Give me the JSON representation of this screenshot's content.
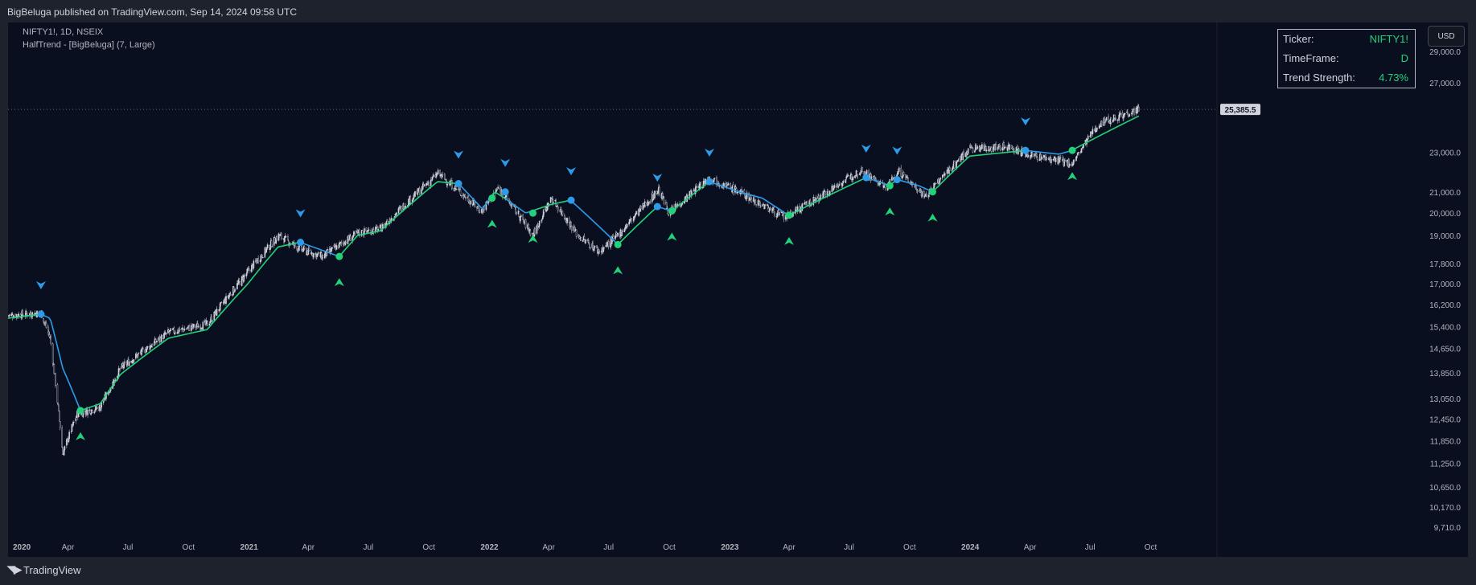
{
  "header": {
    "published": "BigBeluga published on TradingView.com, Sep 14, 2024 09:58 UTC"
  },
  "legend": {
    "symbol": "NIFTY1!, 1D, NSEIX",
    "indicator": "HalfTrend - [BigBeluga] (7, Large)"
  },
  "table": {
    "rows": [
      {
        "label": "Ticker:",
        "value": "NIFTY1!"
      },
      {
        "label": "TimeFrame:",
        "value": "D"
      },
      {
        "label": "Trend Strength:",
        "value": "4.73%"
      }
    ]
  },
  "currency_button": "USD",
  "brand": {
    "icon": "tradingview-logo-icon",
    "name": "TradingView"
  },
  "colors": {
    "bull": "#22d17a",
    "bear": "#2d9be8",
    "candle": "#d1d4dc",
    "background": "#0a0f1f",
    "frame": "#1e222d"
  },
  "chart_data": {
    "type": "candlestick",
    "scale": "log",
    "ylim": [
      9500,
      31000
    ],
    "y_ticks": [
      29000,
      27000,
      23000,
      21000,
      20000,
      19000,
      17800,
      17000,
      16200,
      15400,
      14650,
      13850,
      13050,
      12450,
      11850,
      11250,
      10650,
      10170,
      9710
    ],
    "y_tick_labels": [
      "29,000.0",
      "27,000.0",
      "23,000.0",
      "21,000.0",
      "20,000.0",
      "19,000.0",
      "17,800.0",
      "17,000.0",
      "16,200.0",
      "15,400.0",
      "14,650.0",
      "13,850.0",
      "13,050.0",
      "12,450.0",
      "11,850.0",
      "11,250.0",
      "10,650.0",
      "10,170.0",
      "9,710.0"
    ],
    "last_price": 25385.5,
    "last_price_label": "25,385.5",
    "x_start": "2020-01-01",
    "x_end": "2024-12-31",
    "x_ticks": [
      {
        "date": "2020-01-01",
        "label": "2020"
      },
      {
        "date": "2020-04-01",
        "label": "Apr"
      },
      {
        "date": "2020-07-01",
        "label": "Jul"
      },
      {
        "date": "2020-10-01",
        "label": "Oct"
      },
      {
        "date": "2021-01-01",
        "label": "2021"
      },
      {
        "date": "2021-04-01",
        "label": "Apr"
      },
      {
        "date": "2021-07-01",
        "label": "Jul"
      },
      {
        "date": "2021-10-01",
        "label": "Oct"
      },
      {
        "date": "2022-01-01",
        "label": "2022"
      },
      {
        "date": "2022-04-01",
        "label": "Apr"
      },
      {
        "date": "2022-07-01",
        "label": "Jul"
      },
      {
        "date": "2022-10-01",
        "label": "Oct"
      },
      {
        "date": "2023-01-01",
        "label": "2023"
      },
      {
        "date": "2023-04-01",
        "label": "Apr"
      },
      {
        "date": "2023-07-01",
        "label": "Jul"
      },
      {
        "date": "2023-10-01",
        "label": "Oct"
      },
      {
        "date": "2024-01-01",
        "label": "2024"
      },
      {
        "date": "2024-04-01",
        "label": "Apr"
      },
      {
        "date": "2024-07-01",
        "label": "Jul"
      },
      {
        "date": "2024-10-01",
        "label": "Oct"
      }
    ],
    "price_path": [
      [
        "2020-01-01",
        15800
      ],
      [
        "2020-02-20",
        15900
      ],
      [
        "2020-03-05",
        15000
      ],
      [
        "2020-03-24",
        11500
      ],
      [
        "2020-04-15",
        12600
      ],
      [
        "2020-05-20",
        12800
      ],
      [
        "2020-06-20",
        14000
      ],
      [
        "2020-09-01",
        15200
      ],
      [
        "2020-10-30",
        15500
      ],
      [
        "2020-12-31",
        17500
      ],
      [
        "2021-02-15",
        19000
      ],
      [
        "2021-03-20",
        18400
      ],
      [
        "2021-04-22",
        18100
      ],
      [
        "2021-06-15",
        19100
      ],
      [
        "2021-07-20",
        19300
      ],
      [
        "2021-10-15",
        21900
      ],
      [
        "2021-12-20",
        20100
      ],
      [
        "2022-01-15",
        21200
      ],
      [
        "2022-03-08",
        19000
      ],
      [
        "2022-04-05",
        20700
      ],
      [
        "2022-05-15",
        19000
      ],
      [
        "2022-06-17",
        18300
      ],
      [
        "2022-07-15",
        19000
      ],
      [
        "2022-09-15",
        21100
      ],
      [
        "2022-10-01",
        20000
      ],
      [
        "2022-12-01",
        21700
      ],
      [
        "2023-01-15",
        21000
      ],
      [
        "2023-03-25",
        19800
      ],
      [
        "2023-05-15",
        20700
      ],
      [
        "2023-07-20",
        22100
      ],
      [
        "2023-08-25",
        21200
      ],
      [
        "2023-09-15",
        22000
      ],
      [
        "2023-10-25",
        20800
      ],
      [
        "2023-12-31",
        23200
      ],
      [
        "2024-03-01",
        23300
      ],
      [
        "2024-03-25",
        22900
      ],
      [
        "2024-06-04",
        22400
      ],
      [
        "2024-07-15",
        24600
      ],
      [
        "2024-09-13",
        25385.5
      ]
    ],
    "halftrend_path": [
      [
        "2020-01-01",
        15700
      ],
      [
        "2020-02-20",
        15850
      ],
      [
        "2020-03-05",
        15700
      ],
      [
        "2020-03-24",
        14000
      ],
      [
        "2020-04-20",
        12700
      ],
      [
        "2020-05-20",
        12900
      ],
      [
        "2020-06-20",
        13800
      ],
      [
        "2020-09-01",
        15000
      ],
      [
        "2020-10-30",
        15300
      ],
      [
        "2020-12-31",
        17000
      ],
      [
        "2021-02-15",
        18500
      ],
      [
        "2021-03-20",
        18700
      ],
      [
        "2021-05-18",
        18100
      ],
      [
        "2021-06-15",
        19000
      ],
      [
        "2021-07-20",
        19200
      ],
      [
        "2021-10-15",
        21500
      ],
      [
        "2021-11-15",
        21400
      ],
      [
        "2021-12-21",
        20200
      ],
      [
        "2022-01-10",
        21000
      ],
      [
        "2022-02-25",
        20000
      ],
      [
        "2022-04-05",
        20400
      ],
      [
        "2022-05-05",
        20600
      ],
      [
        "2022-06-20",
        19300
      ],
      [
        "2022-07-15",
        18600
      ],
      [
        "2022-09-13",
        20300
      ],
      [
        "2022-10-05",
        20100
      ],
      [
        "2022-12-01",
        21500
      ],
      [
        "2023-01-15",
        21000
      ],
      [
        "2023-02-20",
        20700
      ],
      [
        "2023-04-01",
        19900
      ],
      [
        "2023-07-27",
        21700
      ],
      [
        "2023-09-01",
        21300
      ],
      [
        "2023-09-12",
        21600
      ],
      [
        "2023-10-15",
        21300
      ],
      [
        "2023-11-05",
        21000
      ],
      [
        "2023-12-31",
        22800
      ],
      [
        "2024-03-25",
        23100
      ],
      [
        "2024-05-15",
        22900
      ],
      [
        "2024-06-04",
        23100
      ],
      [
        "2024-09-13",
        25000
      ]
    ],
    "halftrend_segments": [
      {
        "from": "2020-01-01",
        "to": "2020-02-20",
        "trend": "bull"
      },
      {
        "from": "2020-02-20",
        "to": "2020-04-20",
        "trend": "bear"
      },
      {
        "from": "2020-04-20",
        "to": "2021-03-20",
        "trend": "bull"
      },
      {
        "from": "2021-03-20",
        "to": "2021-05-18",
        "trend": "bear"
      },
      {
        "from": "2021-05-18",
        "to": "2021-11-15",
        "trend": "bull"
      },
      {
        "from": "2021-11-15",
        "to": "2022-01-05",
        "trend": "bear"
      },
      {
        "from": "2022-01-05",
        "to": "2022-01-25",
        "trend": "bull"
      },
      {
        "from": "2022-01-25",
        "to": "2022-03-08",
        "trend": "bear"
      },
      {
        "from": "2022-03-08",
        "to": "2022-05-05",
        "trend": "bull"
      },
      {
        "from": "2022-05-05",
        "to": "2022-07-15",
        "trend": "bear"
      },
      {
        "from": "2022-07-15",
        "to": "2022-09-13",
        "trend": "bull"
      },
      {
        "from": "2022-09-13",
        "to": "2022-10-05",
        "trend": "bear"
      },
      {
        "from": "2022-10-05",
        "to": "2022-12-01",
        "trend": "bull"
      },
      {
        "from": "2022-12-01",
        "to": "2023-04-01",
        "trend": "bear"
      },
      {
        "from": "2023-04-01",
        "to": "2023-07-27",
        "trend": "bull"
      },
      {
        "from": "2023-07-27",
        "to": "2023-09-01",
        "trend": "bear"
      },
      {
        "from": "2023-09-01",
        "to": "2023-09-12",
        "trend": "bull"
      },
      {
        "from": "2023-09-12",
        "to": "2023-11-05",
        "trend": "bear"
      },
      {
        "from": "2023-11-05",
        "to": "2024-03-25",
        "trend": "bull"
      },
      {
        "from": "2024-03-25",
        "to": "2024-06-04",
        "trend": "bear"
      },
      {
        "from": "2024-06-04",
        "to": "2024-09-13",
        "trend": "bull"
      }
    ],
    "signals": [
      {
        "date": "2020-02-20",
        "type": "sell",
        "price": 15850
      },
      {
        "date": "2020-04-20",
        "type": "buy",
        "price": 12700
      },
      {
        "date": "2021-03-20",
        "type": "sell",
        "price": 18700
      },
      {
        "date": "2021-05-18",
        "type": "buy",
        "price": 18100
      },
      {
        "date": "2021-11-15",
        "type": "sell",
        "price": 21400
      },
      {
        "date": "2022-01-05",
        "type": "buy",
        "price": 20700
      },
      {
        "date": "2022-01-25",
        "type": "sell",
        "price": 21000
      },
      {
        "date": "2022-03-08",
        "type": "buy",
        "price": 20000
      },
      {
        "date": "2022-05-05",
        "type": "sell",
        "price": 20600
      },
      {
        "date": "2022-07-15",
        "type": "buy",
        "price": 18600
      },
      {
        "date": "2022-09-13",
        "type": "sell",
        "price": 20300
      },
      {
        "date": "2022-10-05",
        "type": "buy",
        "price": 20100
      },
      {
        "date": "2022-12-01",
        "type": "sell",
        "price": 21500
      },
      {
        "date": "2023-04-01",
        "type": "buy",
        "price": 19900
      },
      {
        "date": "2023-07-27",
        "type": "sell",
        "price": 21700
      },
      {
        "date": "2023-09-01",
        "type": "buy",
        "price": 21300
      },
      {
        "date": "2023-09-12",
        "type": "sell",
        "price": 21600
      },
      {
        "date": "2023-11-05",
        "type": "buy",
        "price": 21000
      },
      {
        "date": "2024-03-25",
        "type": "sell",
        "price": 23100
      },
      {
        "date": "2024-06-04",
        "type": "buy",
        "price": 23100
      }
    ]
  }
}
